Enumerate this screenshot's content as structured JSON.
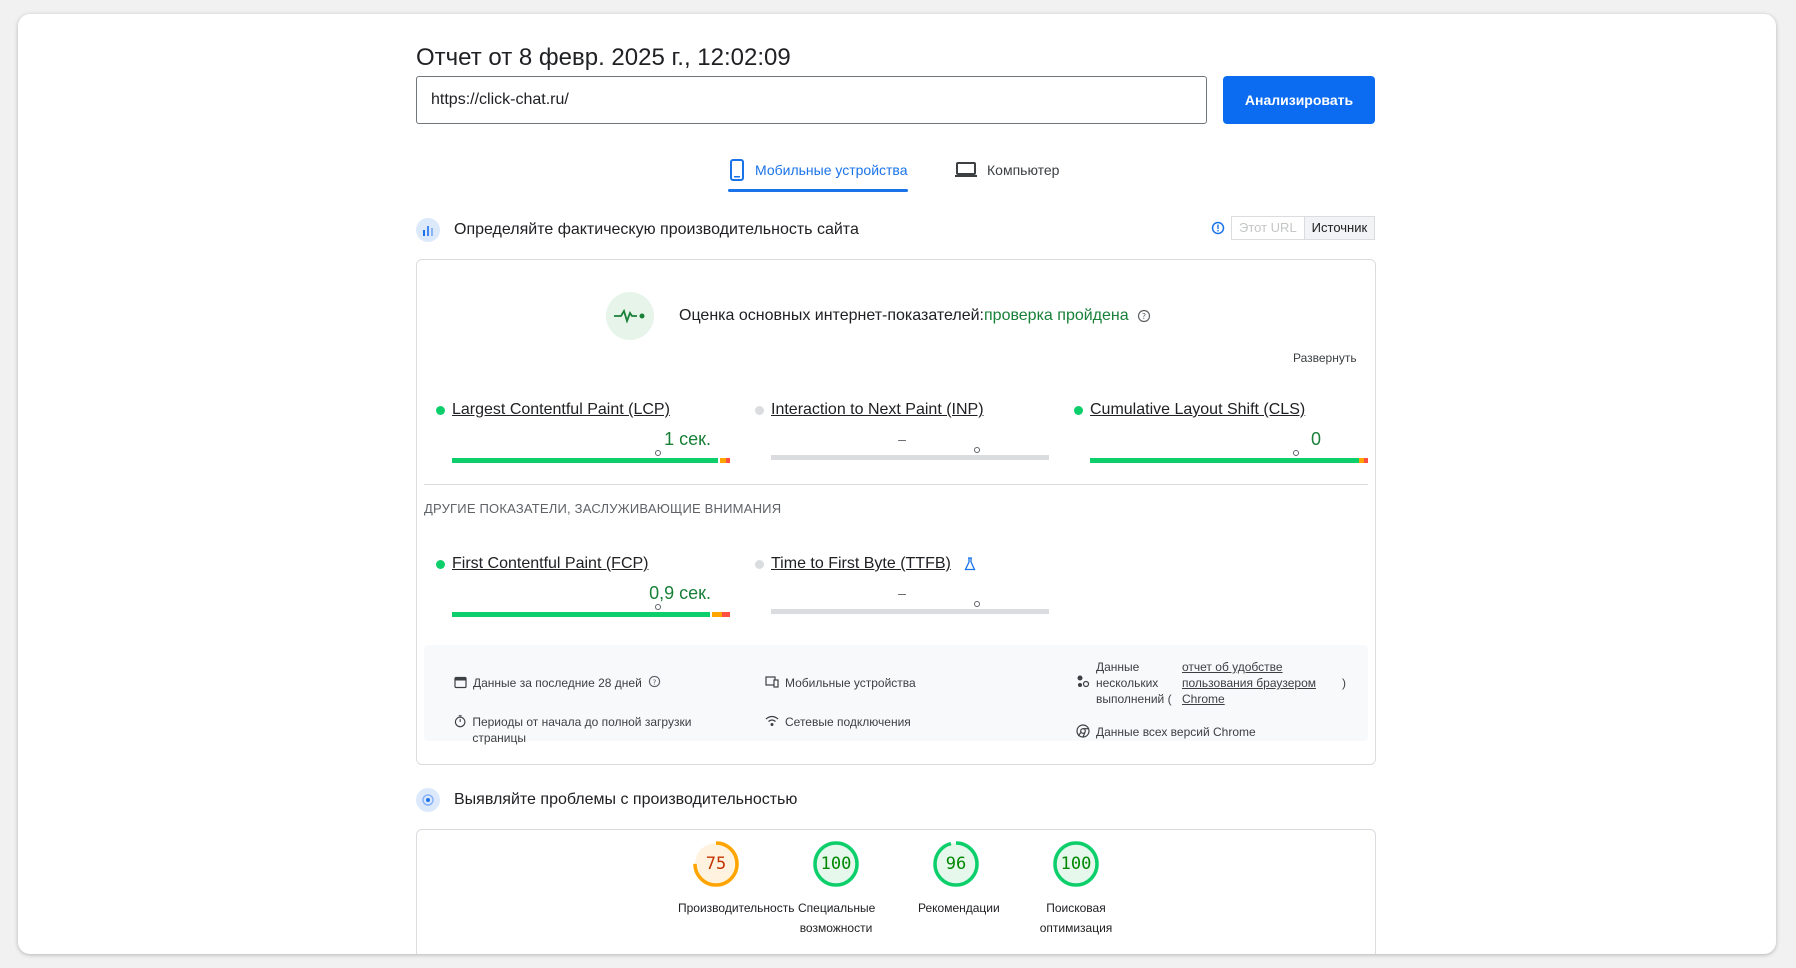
{
  "report": {
    "title": "Отчет от 8 февр. 2025 г., 12:02:09",
    "url_value": "https://click-chat.ru/",
    "analyze_label": "Анализировать"
  },
  "tabs": [
    {
      "label": "Мобильные устройства",
      "icon": "smartphone-icon",
      "active": true
    },
    {
      "label": "Компьютер",
      "icon": "laptop-icon",
      "active": false
    }
  ],
  "field": {
    "heading": "Определяйте фактическую производительность сайта",
    "toggle": {
      "this_url": "Этот URL",
      "origin": "Источник"
    },
    "cwv_label": "Оценка основных интернет-показателей:",
    "cwv_status": "проверка пройдена",
    "expand": "Развернуть",
    "metrics": [
      {
        "name": "Largest Contentful Paint (LCP)",
        "value": "1 сек.",
        "status": "good",
        "fractions": [
          0.75,
          0.04,
          0.01
        ]
      },
      {
        "name": "Interaction to Next Paint (INP)",
        "value": "–",
        "status": "none"
      },
      {
        "name": "Cumulative Layout Shift (CLS)",
        "value": "0",
        "status": "good",
        "fractions": [
          0.975,
          0.015,
          0.01
        ]
      }
    ],
    "other_heading": "ДРУГИЕ ПОКАЗАТЕЛИ, ЗАСЛУЖИВАЮЩИЕ ВНИМАНИЯ",
    "other_metrics": [
      {
        "name": "First Contentful Paint (FCP)",
        "value": "0,9 сек.",
        "status": "good",
        "fractions": [
          0.75,
          0.05,
          0.03
        ]
      },
      {
        "name": "Time to First Byte (TTFB)",
        "value": "–",
        "status": "none",
        "icon": "flask-icon"
      }
    ],
    "info": {
      "period": "Данные за последние 28 дней",
      "devices": "Мобильные устройства",
      "samples_prefix": "Данные нескольких выполнений (",
      "samples_link": "отчет об удобстве пользования браузером Chrome",
      "samples_suffix": ")",
      "duration": "Периоды от начала до полной загрузки страницы",
      "network": "Сетевые подключения",
      "versions": "Данные всех версий Chrome"
    }
  },
  "lab": {
    "heading": "Выявляйте проблемы с производительностью",
    "scores": [
      {
        "value": "75",
        "label": "Производительность",
        "score": 0.75,
        "color": "#ffa400"
      },
      {
        "value": "100",
        "label": "Специальные возможности",
        "score": 1.0,
        "color": "#0cce6b"
      },
      {
        "value": "96",
        "label": "Рекомендации",
        "score": 0.96,
        "color": "#0cce6b"
      },
      {
        "value": "100",
        "label": "Поисковая оптимизация",
        "score": 1.0,
        "color": "#0cce6b"
      }
    ]
  },
  "colors": {
    "accent": "#1a73e8",
    "good": "#0cce6b",
    "average": "#ffa400",
    "poor": "#ff4e42",
    "good_text": "#188038"
  }
}
